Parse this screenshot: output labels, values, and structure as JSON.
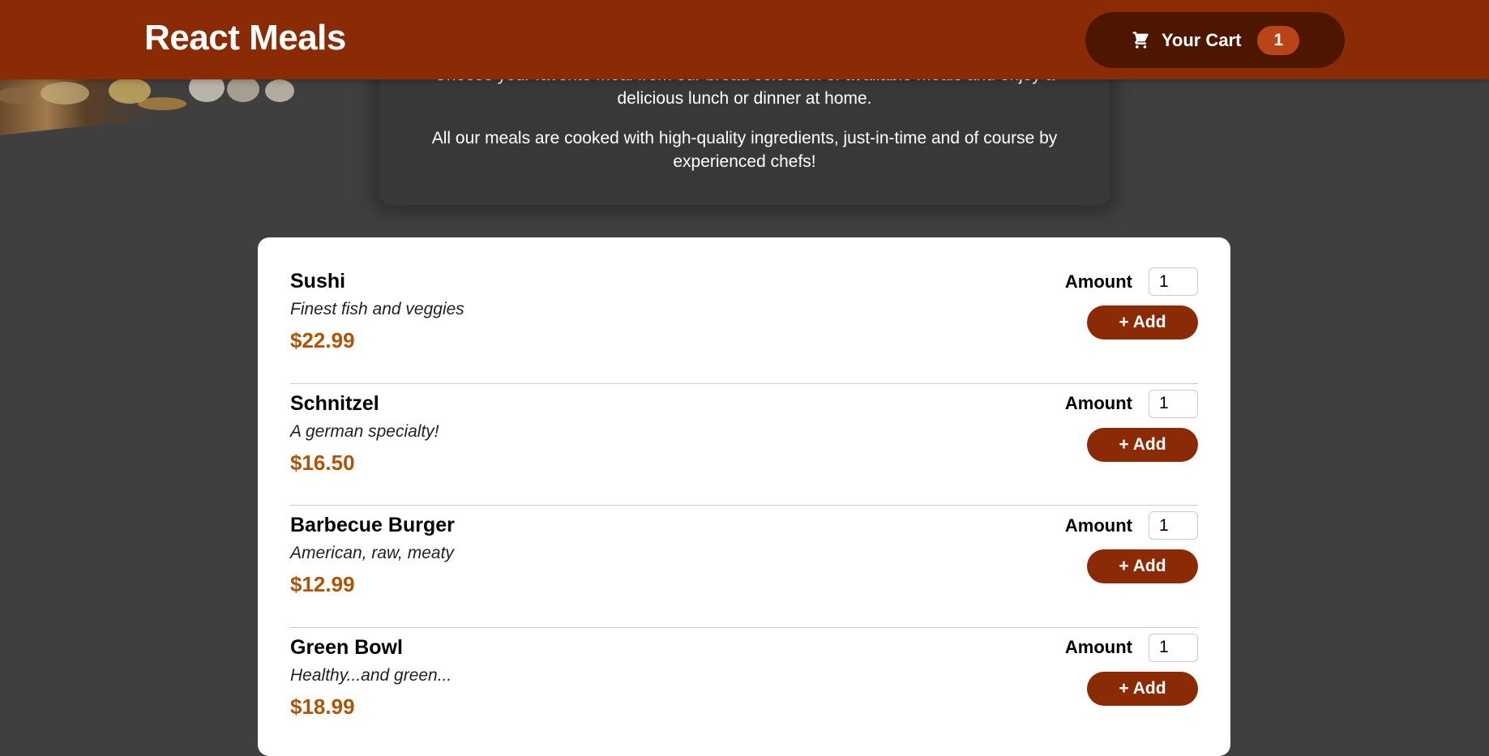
{
  "header": {
    "title": "React Meals",
    "cart": {
      "icon": "shopping-cart-icon",
      "label": "Your Cart",
      "count": "1"
    }
  },
  "summary": {
    "paragraph1": "Choose your favorite meal from our broad selection of available meals and enjoy a delicious lunch or dinner at home.",
    "paragraph2": "All our meals are cooked with high-quality ingredients, just-in-time and of course by experienced chefs!"
  },
  "meals": [
    {
      "name": "Sushi",
      "description": "Finest fish and veggies",
      "price": "$22.99",
      "amount_label": "Amount",
      "amount_value": "1",
      "add_label": "+ Add"
    },
    {
      "name": "Schnitzel",
      "description": "A german specialty!",
      "price": "$16.50",
      "amount_label": "Amount",
      "amount_value": "1",
      "add_label": "+ Add"
    },
    {
      "name": "Barbecue Burger",
      "description": "American, raw, meaty",
      "price": "$12.99",
      "amount_label": "Amount",
      "amount_value": "1",
      "add_label": "+ Add"
    },
    {
      "name": "Green Bowl",
      "description": "Healthy...and green...",
      "price": "$18.99",
      "amount_label": "Amount",
      "amount_value": "1",
      "add_label": "+ Add"
    }
  ],
  "colors": {
    "header": "#8a2b06",
    "cart_button": "#4d1601",
    "cart_badge": "#b94517",
    "price": "#ad5502",
    "add_button": "#8a2b06",
    "page_background": "#3f3f3f",
    "summary_background": "#383838"
  }
}
